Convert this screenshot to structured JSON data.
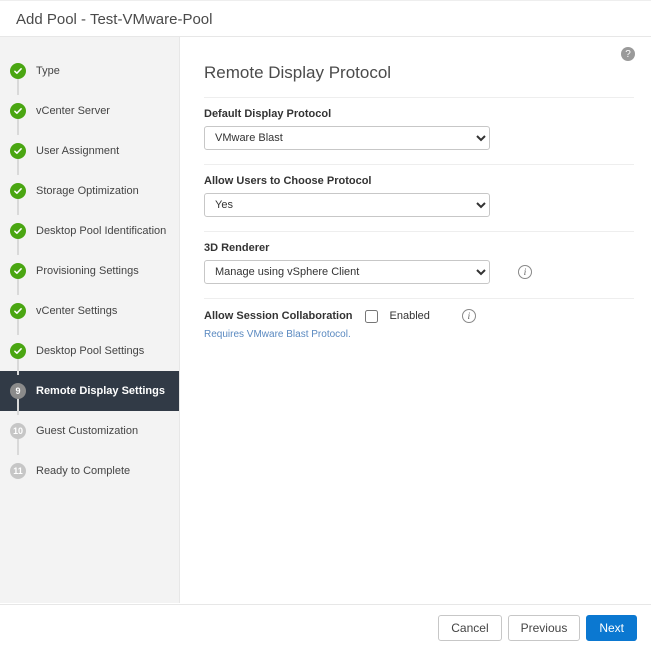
{
  "header": {
    "title": "Add Pool - Test-VMware-Pool"
  },
  "sidebar": {
    "steps": [
      {
        "label": "Type",
        "state": "complete"
      },
      {
        "label": "vCenter Server",
        "state": "complete"
      },
      {
        "label": "User Assignment",
        "state": "complete"
      },
      {
        "label": "Storage Optimization",
        "state": "complete"
      },
      {
        "label": "Desktop Pool Identification",
        "state": "complete"
      },
      {
        "label": "Provisioning Settings",
        "state": "complete"
      },
      {
        "label": "vCenter Settings",
        "state": "complete"
      },
      {
        "label": "Desktop Pool Settings",
        "state": "complete"
      },
      {
        "label": "Remote Display Settings",
        "state": "current",
        "num": "9"
      },
      {
        "label": "Guest Customization",
        "state": "pending",
        "num": "10"
      },
      {
        "label": "Ready to Complete",
        "state": "pending",
        "num": "11"
      }
    ]
  },
  "main": {
    "section_title": "Remote Display Protocol",
    "default_protocol": {
      "label": "Default Display Protocol",
      "value": "VMware Blast"
    },
    "allow_choose": {
      "label": "Allow Users to Choose Protocol",
      "value": "Yes"
    },
    "renderer": {
      "label": "3D Renderer",
      "value": "Manage using vSphere Client"
    },
    "session_collab": {
      "label": "Allow Session Collaboration",
      "checkbox_label": "Enabled",
      "checked": false
    },
    "note": "Requires VMware Blast Protocol."
  },
  "footer": {
    "cancel": "Cancel",
    "previous": "Previous",
    "next": "Next"
  }
}
